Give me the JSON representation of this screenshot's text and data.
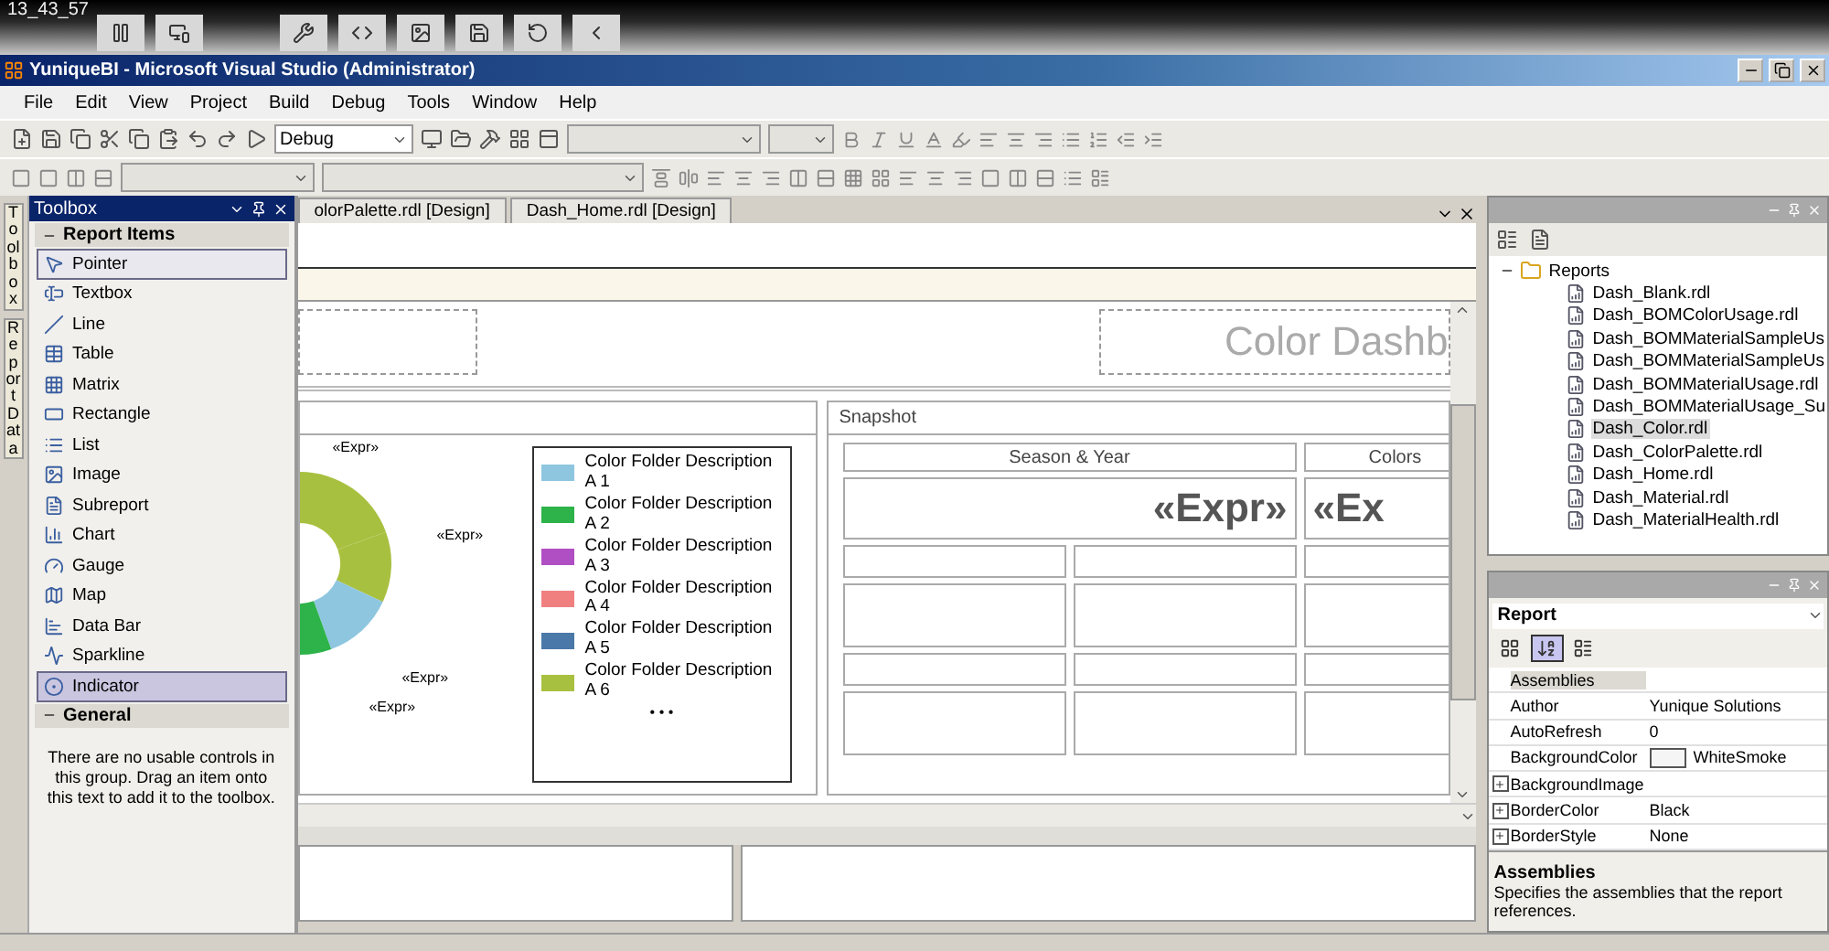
{
  "recorder": {
    "time": "13_43_57"
  },
  "window": {
    "title": "YuniqueBI - Microsoft Visual Studio (Administrator)"
  },
  "menu": [
    "File",
    "Edit",
    "View",
    "Project",
    "Build",
    "Debug",
    "Tools",
    "Window",
    "Help"
  ],
  "toolbar": {
    "configuration": "Debug"
  },
  "side_tabs": [
    "Toolbox",
    "Report Data"
  ],
  "toolbox": {
    "title": "Toolbox",
    "groups": [
      {
        "label": "Report Items",
        "expanded": true,
        "items": [
          {
            "label": "Pointer",
            "selected": true,
            "hover": false
          },
          {
            "label": "Textbox",
            "selected": false,
            "hover": false
          },
          {
            "label": "Line",
            "selected": false,
            "hover": false
          },
          {
            "label": "Table",
            "selected": false,
            "hover": false
          },
          {
            "label": "Matrix",
            "selected": false,
            "hover": false
          },
          {
            "label": "Rectangle",
            "selected": false,
            "hover": false
          },
          {
            "label": "List",
            "selected": false,
            "hover": false
          },
          {
            "label": "Image",
            "selected": false,
            "hover": false
          },
          {
            "label": "Subreport",
            "selected": false,
            "hover": false
          },
          {
            "label": "Chart",
            "selected": false,
            "hover": false
          },
          {
            "label": "Gauge",
            "selected": false,
            "hover": false
          },
          {
            "label": "Map",
            "selected": false,
            "hover": false
          },
          {
            "label": "Data Bar",
            "selected": false,
            "hover": false
          },
          {
            "label": "Sparkline",
            "selected": false,
            "hover": false
          },
          {
            "label": "Indicator",
            "selected": false,
            "hover": true
          }
        ]
      },
      {
        "label": "General",
        "expanded": true,
        "note": "There are no usable controls in this group. Drag an item onto this text to add it to the toolbox."
      }
    ]
  },
  "document_tabs": [
    {
      "label": "olorPalette.rdl [Design]"
    },
    {
      "label": "Dash_Home.rdl [Design]"
    }
  ],
  "report": {
    "title": "Color Dashb",
    "chart": {
      "labels": [
        "«Expr»",
        "«Expr»",
        "«Expr»",
        "«Expr»"
      ],
      "legend": [
        {
          "label": "Color Folder Description A 1",
          "color": "#8ec6e0"
        },
        {
          "label": "Color Folder Description A 2",
          "color": "#2db34a"
        },
        {
          "label": "Color Folder Description A 3",
          "color": "#b04fc4"
        },
        {
          "label": "Color Folder Description A 4",
          "color": "#f08080"
        },
        {
          "label": "Color Folder Description A 5",
          "color": "#4a78a8"
        },
        {
          "label": "Color Folder Description A 6",
          "color": "#a8c040"
        }
      ],
      "more": "• • •"
    },
    "snapshot": {
      "title": "Snapshot",
      "headers": [
        "Season & Year",
        "Colors"
      ],
      "values": [
        "«Expr»",
        "«Ex"
      ]
    }
  },
  "solution_explorer": {
    "root": {
      "label": "Reports",
      "expanded": true,
      "children": [
        {
          "label": "Dash_Blank.rdl",
          "selected": false
        },
        {
          "label": "Dash_BOMColorUsage.rdl",
          "selected": false
        },
        {
          "label": "Dash_BOMMaterialSampleUs",
          "selected": false
        },
        {
          "label": "Dash_BOMMaterialSampleUs",
          "selected": false
        },
        {
          "label": "Dash_BOMMaterialUsage.rdl",
          "selected": false
        },
        {
          "label": "Dash_BOMMaterialUsage_Su",
          "selected": false
        },
        {
          "label": "Dash_Color.rdl",
          "selected": true
        },
        {
          "label": "Dash_ColorPalette.rdl",
          "selected": false
        },
        {
          "label": "Dash_Home.rdl",
          "selected": false
        },
        {
          "label": "Dash_Material.rdl",
          "selected": false
        },
        {
          "label": "Dash_MaterialHealth.rdl",
          "selected": false
        }
      ]
    }
  },
  "properties": {
    "object": "Report",
    "view_buttons": [
      {
        "selected": false
      },
      {
        "selected": true
      },
      {
        "selected": false
      }
    ],
    "rows": [
      {
        "name": "Assemblies",
        "expandable": false,
        "selected": true
      },
      {
        "name": "Author",
        "value": "Yunique Solutions",
        "expandable": false,
        "selected": false
      },
      {
        "name": "AutoRefresh",
        "value": "0",
        "expandable": false,
        "selected": false
      },
      {
        "name": "BackgroundColor",
        "value": "WhiteSmoke",
        "color": "#f5f5f5",
        "expandable": false,
        "selected": false
      },
      {
        "name": "BackgroundImage",
        "expandable": true,
        "selected": false
      },
      {
        "name": "BorderColor",
        "value": "Black",
        "expandable": true,
        "selected": false
      },
      {
        "name": "BorderStyle",
        "value": "None",
        "expandable": true,
        "selected": false
      }
    ],
    "description_title": "Assemblies",
    "description": "Specifies the assemblies that the report references."
  }
}
